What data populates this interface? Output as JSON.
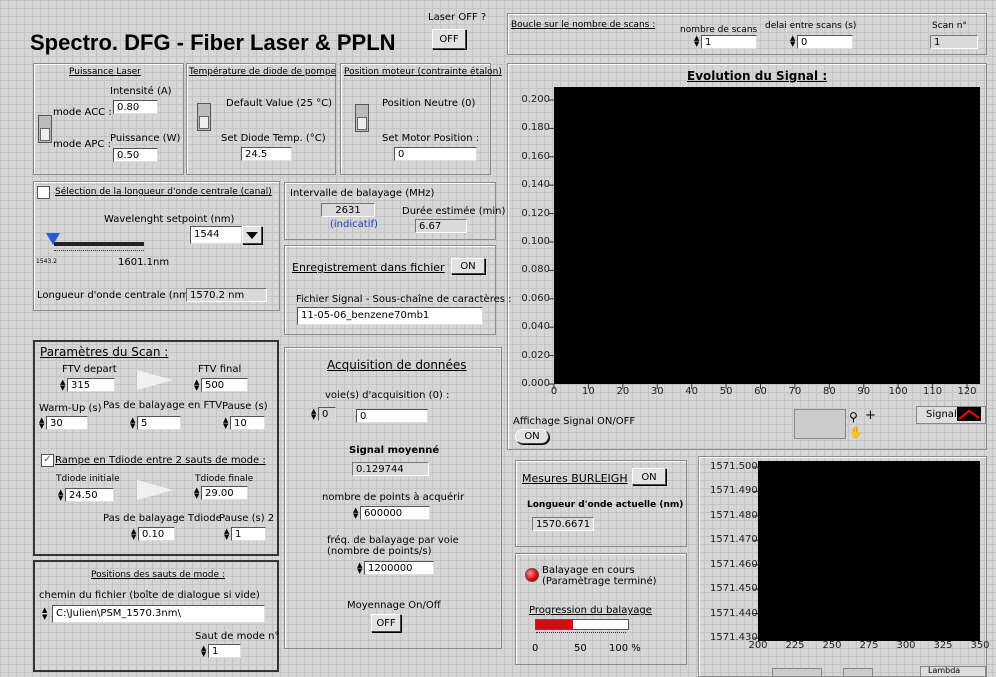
{
  "title": "Spectro. DFG - Fiber Laser & PPLN",
  "laser": {
    "label": "Laser OFF ?",
    "button": "OFF"
  },
  "scan_loop": {
    "title": "Boucle sur le nombre de scans :",
    "nb_scans_label": "nombre de scans",
    "nb_scans": "1",
    "delay_label": "delai entre scans (s)",
    "delay": "0",
    "scan_n_label": "Scan n°",
    "scan_n": "1"
  },
  "laser_power": {
    "title": "Puissance Laser",
    "mode_acc": "mode ACC :",
    "mode_apc": "mode APC :",
    "intensity_label": "Intensité (A)",
    "intensity": "0.80",
    "power_label": "Puissance (W)",
    "power": "0.50"
  },
  "diode_temp": {
    "title": "Température de diode de pompe",
    "default_label": "Default Value (25 °C)",
    "set_label": "Set Diode Temp. (°C)",
    "value": "24.5"
  },
  "motor": {
    "title": "Position moteur (contrainte étalon)",
    "neutral_label": "Position Neutre (0)",
    "set_label": "Set Motor Position :",
    "value": "0"
  },
  "wavelength": {
    "checkbox_label": "Sélection de la longueur d'onde centrale (canal)",
    "setpoint_label": "Wavelenght setpoint (nm)",
    "setpoint": "1544",
    "min": "1543.2",
    "max": "1601.1nm",
    "central_label": "Longueur d'onde centrale (nm) :",
    "central": "1570.2 nm"
  },
  "sweep_interval": {
    "title": "Intervalle de balayage (MHz)",
    "value": "2631",
    "indicatif": "(indicatif)",
    "duration_label": "Durée estimée (min)",
    "duration": "6.67"
  },
  "file_save": {
    "title": "Enregistrement dans fichier",
    "toggle": "ON",
    "file_label": "Fichier Signal - Sous-chaîne de caractères :",
    "file": "11-05-06_benzene70mb1"
  },
  "scan_params": {
    "title": "Paramètres du Scan :",
    "ftv_start_label": "FTV depart",
    "ftv_start": "315",
    "ftv_end_label": "FTV final",
    "ftv_end": "500",
    "warmup_label": "Warm-Up (s)",
    "warmup": "30",
    "step_ftv_label": "Pas de balayage en FTV",
    "step_ftv": "5",
    "pause_label": "Pause (s)",
    "pause": "10",
    "ramp_label": "Rampe en Tdiode entre 2 sauts de mode :",
    "tdiode_init_label": "Tdiode initiale",
    "tdiode_init": "24.50",
    "tdiode_end_label": "Tdiode finale",
    "tdiode_end": "29.00",
    "step_tdiode_label": "Pas de balayage Tdiode",
    "step_tdiode": "0.10",
    "pause2_label": "Pause (s) 2",
    "pause2": "1"
  },
  "mode_jumps": {
    "title": "Positions des sauts de mode :",
    "path_label": "chemin du fichier (boîte de dialogue si vide)",
    "path": "C:\\Julien\\PSM_1570.3nm\\",
    "jump_label": "Saut de mode n°",
    "jump": "1"
  },
  "acquisition": {
    "title": "Acquisition de données",
    "channels_label": "voie(s) d'acquisition (0) :",
    "channel_index": "0",
    "channel": "0",
    "avg_signal_label": "Signal moyenné",
    "avg_signal": "0.129744",
    "npoints_label": "nombre de points à acquérir",
    "npoints": "600000",
    "freq_label": "fréq. de balayage par voie\n(nombre de points/s)",
    "freq": "1200000",
    "avg_label": "Moyennage On/Off",
    "avg_button": "OFF"
  },
  "signal_chart": {
    "title": "Evolution du Signal :",
    "toggle_label": "Affichage Signal ON/OFF",
    "toggle": "ON",
    "legend": "Signal",
    "colors": {
      "plot_bg": "#000000",
      "trace": "#ff0000"
    }
  },
  "burleigh": {
    "title": "Mesures BURLEIGH",
    "toggle": "ON",
    "current_label": "Longueur d'onde actuelle (nm)",
    "current": "1570.6671"
  },
  "progress": {
    "led_label": "Balayage en cours\n(Paramètrage terminé)",
    "title": "Progression du balayage",
    "value_percent": 40,
    "ticks": [
      "0",
      "50",
      "100 %"
    ],
    "colors": {
      "led": "#e00000",
      "fill": "#d01010"
    }
  },
  "lambda_chart": {
    "legend": "Lambda"
  },
  "chart_data": [
    {
      "type": "line",
      "title": "Evolution du Signal :",
      "x_ticks": [
        "0",
        "10",
        "20",
        "30",
        "40",
        "50",
        "60",
        "70",
        "80",
        "90",
        "100",
        "110",
        "120"
      ],
      "y_ticks": [
        "0.200",
        "0.180",
        "0.160",
        "0.140",
        "0.120",
        "0.100",
        "0.080",
        "0.060",
        "0.040",
        "0.020",
        "0.000"
      ],
      "xlim": [
        0,
        120
      ],
      "ylim": [
        0,
        0.2
      ],
      "series": []
    },
    {
      "type": "line",
      "x_ticks": [
        "200",
        "225",
        "250",
        "275",
        "300",
        "325",
        "350"
      ],
      "y_ticks": [
        "1571.500",
        "1571.490",
        "1571.480",
        "1571.470",
        "1571.460",
        "1571.450",
        "1571.440",
        "1571.430"
      ],
      "xlim": [
        200,
        350
      ],
      "ylim": [
        1571.43,
        1571.5
      ],
      "series": []
    }
  ]
}
